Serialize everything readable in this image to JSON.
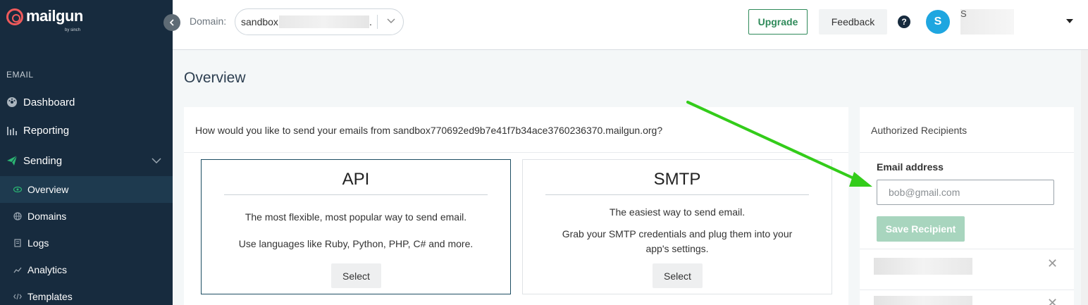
{
  "sidebar": {
    "logo_text": "mailgun",
    "logo_sub": "by sinch",
    "section_label": "EMAIL",
    "items": [
      {
        "label": "Dashboard",
        "icon": "dashboard-icon"
      },
      {
        "label": "Reporting",
        "icon": "bar-chart-icon"
      },
      {
        "label": "Sending",
        "icon": "paper-plane-icon"
      }
    ],
    "sub_items": [
      {
        "label": "Overview",
        "icon": "eye-icon",
        "active": true
      },
      {
        "label": "Domains",
        "icon": "globe-icon"
      },
      {
        "label": "Logs",
        "icon": "document-icon"
      },
      {
        "label": "Analytics",
        "icon": "trend-icon"
      },
      {
        "label": "Templates",
        "icon": "code-icon"
      }
    ]
  },
  "topbar": {
    "domain_label": "Domain:",
    "domain_value": "sandbox",
    "domain_suffix": ".",
    "upgrade_label": "Upgrade",
    "feedback_label": "Feedback",
    "help_glyph": "?",
    "avatar_initial": "S",
    "user_name": "S"
  },
  "main": {
    "title": "Overview",
    "question": "How would you like to send your emails from sandbox770692ed9b7e41f7b34ace3760236370.mailgun.org?",
    "options": [
      {
        "title": "API",
        "desc1": "The most flexible, most popular way to send email.",
        "desc2": "Use languages like Ruby, Python, PHP, C# and more.",
        "button": "Select"
      },
      {
        "title": "SMTP",
        "desc1": "The easiest way to send email.",
        "desc2": "Grab your SMTP credentials and plug them into your app's settings.",
        "button": "Select"
      }
    ]
  },
  "recipients": {
    "title": "Authorized Recipients",
    "email_label": "Email address",
    "email_placeholder": "bob@gmail.com",
    "email_value": "",
    "save_label": "Save Recipient",
    "remove_glyph": "✕"
  },
  "colors": {
    "sidebar_bg": "#172b3e",
    "accent_green": "#2f8a5a",
    "arrow_green": "#33cc1a",
    "avatar_blue": "#1fa6e0",
    "logo_red": "#f05a5b"
  }
}
